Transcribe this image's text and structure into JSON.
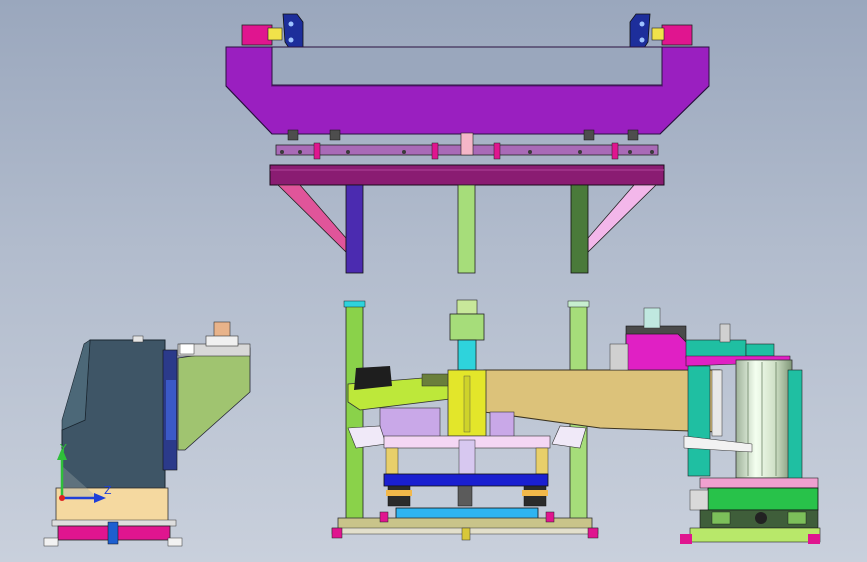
{
  "triad": {
    "y_label": "Y",
    "z_label": "Z",
    "y_color": "#2fbf3a",
    "z_color": "#1f3fd8",
    "origin_color": "#e02020"
  },
  "colors": {
    "frame_purple": "#9a1fc0",
    "frame_dark_purple": "#8a1c72",
    "magenta": "#e0158f",
    "pink_strut": "#e0559a",
    "light_pink_strut": "#f3b7ea",
    "post_green": "#a6dd7a",
    "post_dark_green": "#4a7a3a",
    "post_indigo": "#4b2bb0",
    "lime": "#bde83a",
    "tan_beam": "#dcc27a",
    "slate_block": "#3e5566",
    "cyan": "#2ed3dc",
    "blue_plate": "#1a1fd0",
    "yellow": "#e3e62a",
    "lavender": "#c9a8e8",
    "teal": "#1fbfa2",
    "peach": "#f5d9a0",
    "navy_clamp": "#1d2e9b"
  }
}
